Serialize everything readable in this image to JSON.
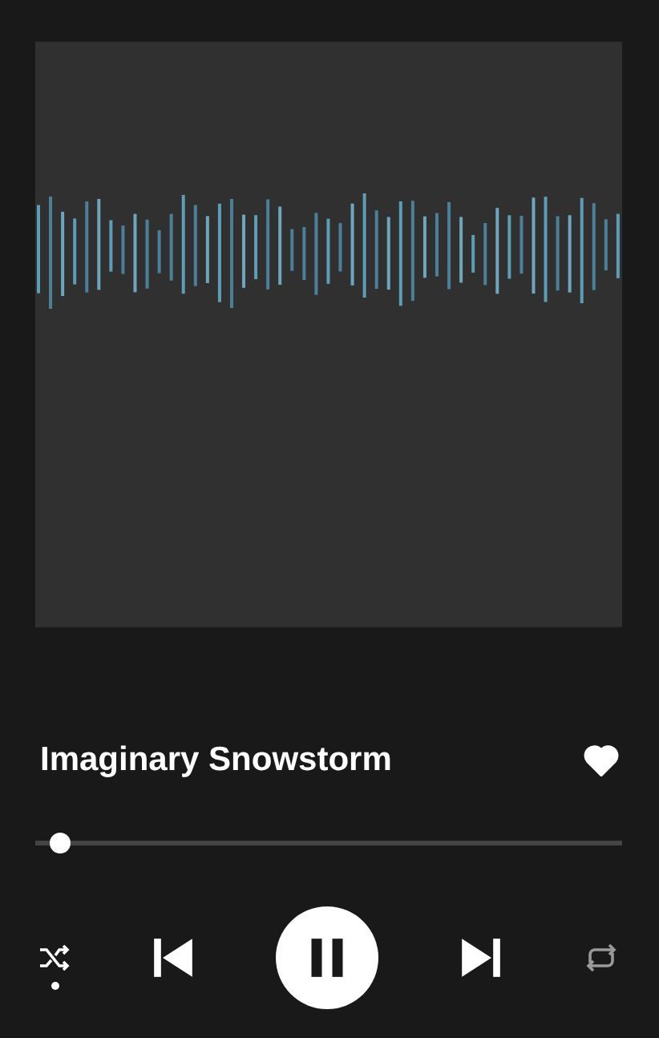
{
  "track": {
    "title": "Imaginary Snowstorm",
    "liked": true
  },
  "progress": {
    "level": 0.02
  },
  "controls": {
    "shuffle": true,
    "playing": true,
    "repeat": false
  }
}
